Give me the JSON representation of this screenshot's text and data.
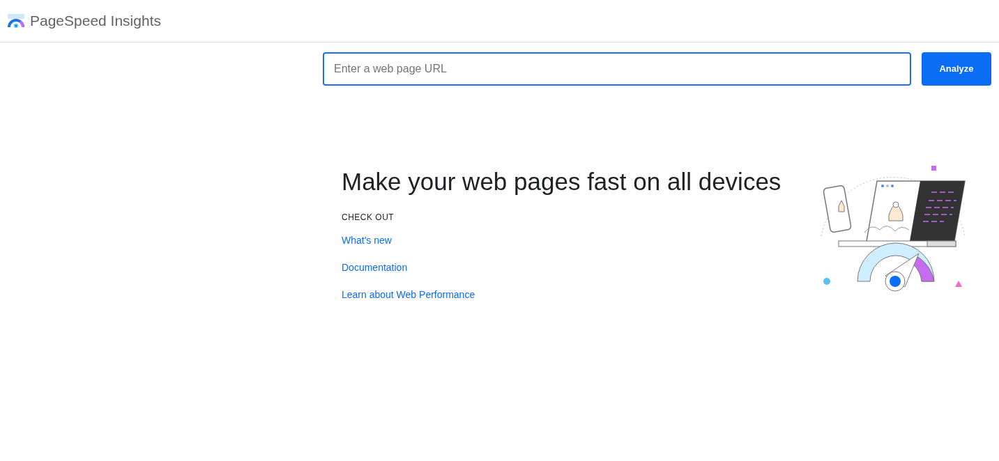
{
  "header": {
    "title": "PageSpeed Insights"
  },
  "search": {
    "placeholder": "Enter a web page URL",
    "button": "Analyze"
  },
  "hero": {
    "heading": "Make your web pages fast on all devices",
    "section_label": "CHECK OUT",
    "links": [
      "What's new",
      "Documentation",
      "Learn about Web Performance"
    ]
  }
}
